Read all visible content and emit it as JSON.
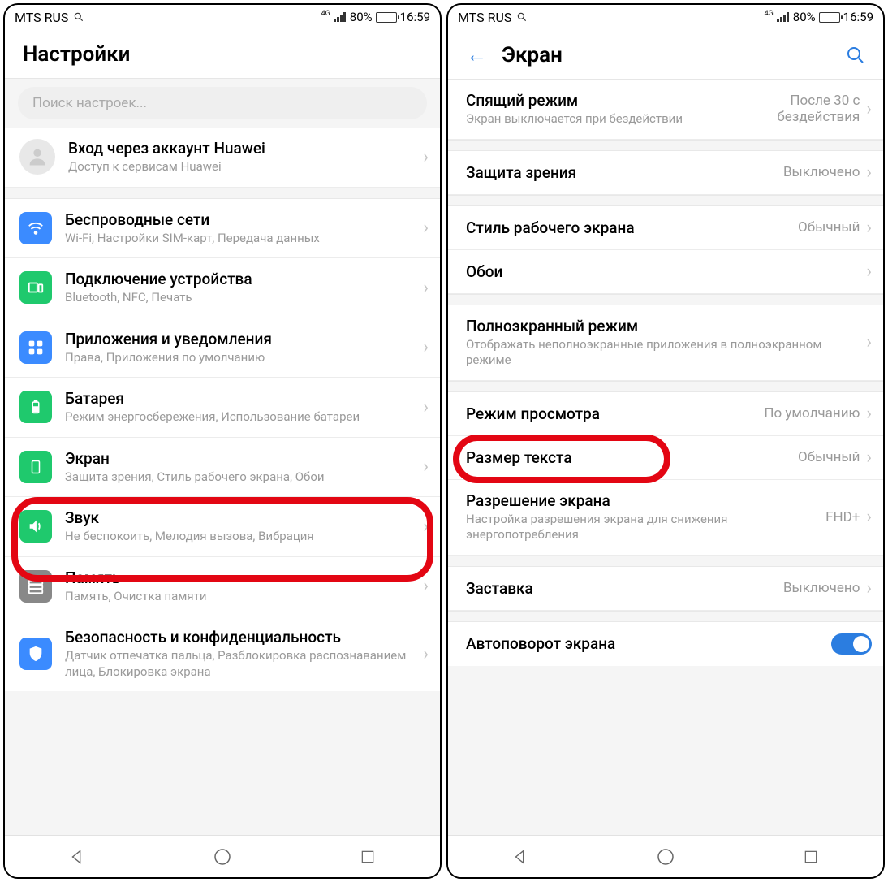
{
  "statusbar": {
    "carrier": "MTS RUS",
    "network": "4G",
    "battery_pct": "80%",
    "time": "16:59"
  },
  "left": {
    "title": "Настройки",
    "search_placeholder": "Поиск настроек...",
    "account": {
      "title": "Вход через аккаунт Huawei",
      "sub": "Доступ к сервисам Huawei"
    },
    "items": [
      {
        "title": "Беспроводные сети",
        "sub": "Wi-Fi, Настройки SIM-карт, Передача данных"
      },
      {
        "title": "Подключение устройства",
        "sub": "Bluetooth, NFC, Печать"
      },
      {
        "title": "Приложения и уведомления",
        "sub": "Права, Приложения по умолчанию"
      },
      {
        "title": "Батарея",
        "sub": "Режим энергосбережения, Использование батареи"
      },
      {
        "title": "Экран",
        "sub": "Защита зрения, Стиль рабочего экрана, Обои"
      },
      {
        "title": "Звук",
        "sub": "Не беспокоить, Мелодия вызова, Вибрация"
      },
      {
        "title": "Память",
        "sub": "Память, Очистка памяти"
      },
      {
        "title": "Безопасность и конфиденциальность",
        "sub": "Датчик отпечатка пальца, Разблокировка распознаванием лица, Блокировка экрана"
      }
    ]
  },
  "right": {
    "title": "Экран",
    "items": [
      {
        "title": "Спящий режим",
        "sub": "Экран выключается при бездействии",
        "value": "После 30 с бездействия"
      },
      {
        "title": "Защита зрения",
        "value": "Выключено"
      },
      {
        "title": "Стиль рабочего экрана",
        "value": "Обычный"
      },
      {
        "title": "Обои",
        "value": ""
      },
      {
        "title": "Полноэкранный режим",
        "sub": "Отображать неполноэкранные приложения в полноэкранном режиме"
      },
      {
        "title": "Режим просмотра",
        "value": "По умолчанию"
      },
      {
        "title": "Размер текста",
        "value": "Обычный"
      },
      {
        "title": "Разрешение экрана",
        "sub": "Настройка разрешения экрана для снижения энергопотребления",
        "value": "FHD+"
      },
      {
        "title": "Заставка",
        "value": "Выключено"
      },
      {
        "title": "Автоповорот экрана"
      }
    ]
  }
}
